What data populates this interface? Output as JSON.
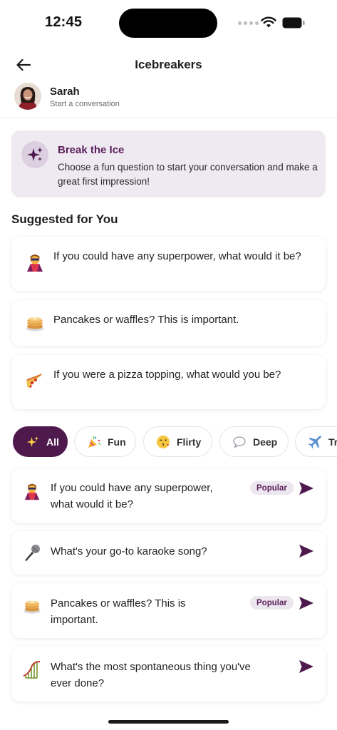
{
  "status_bar": {
    "time": "12:45"
  },
  "header": {
    "title": "Icebreakers",
    "back_icon": "arrow-left-icon"
  },
  "contact": {
    "name": "Sarah",
    "subtitle": "Start a conversation"
  },
  "banner": {
    "icon": "sparkles-icon",
    "title": "Break the Ice",
    "description": "Choose a fun question to start your conversation and make a great first impression!"
  },
  "suggested": {
    "title": "Suggested for You",
    "items": [
      {
        "icon": "superhero-icon",
        "text": "If you could have any superpower, what would it be?"
      },
      {
        "icon": "pancakes-icon",
        "text": "Pancakes or waffles? This is important."
      },
      {
        "icon": "pizza-icon",
        "text": "If you were a pizza topping, what would you be?"
      }
    ]
  },
  "categories": [
    {
      "icon": "sparkles-icon",
      "label": "All",
      "selected": true
    },
    {
      "icon": "party-popper-icon",
      "label": "Fun",
      "selected": false
    },
    {
      "icon": "kiss-face-icon",
      "label": "Flirty",
      "selected": false
    },
    {
      "icon": "speech-bubble-icon",
      "label": "Deep",
      "selected": false
    },
    {
      "icon": "airplane-icon",
      "label": "Tr",
      "selected": false
    }
  ],
  "questions": [
    {
      "icon": "superhero-icon",
      "line1": "If you could have any superpower,",
      "line2": "what would it be?",
      "badge": "Popular"
    },
    {
      "icon": "microphone-icon",
      "line1": "What's your go-to karaoke song?",
      "line2": "",
      "badge": ""
    },
    {
      "icon": "pancakes-icon",
      "line1": "Pancakes or waffles? This is",
      "line2": "important.",
      "badge": "Popular"
    },
    {
      "icon": "roller-coaster-icon",
      "line1": "What's the most spontaneous thing you've",
      "line2": "ever done?",
      "badge": ""
    }
  ],
  "colors": {
    "accent": "#4e1a4e",
    "banner_bg": "#efe9f1",
    "badge_bg": "#ece6ee",
    "title_purple": "#5a1f5a"
  }
}
